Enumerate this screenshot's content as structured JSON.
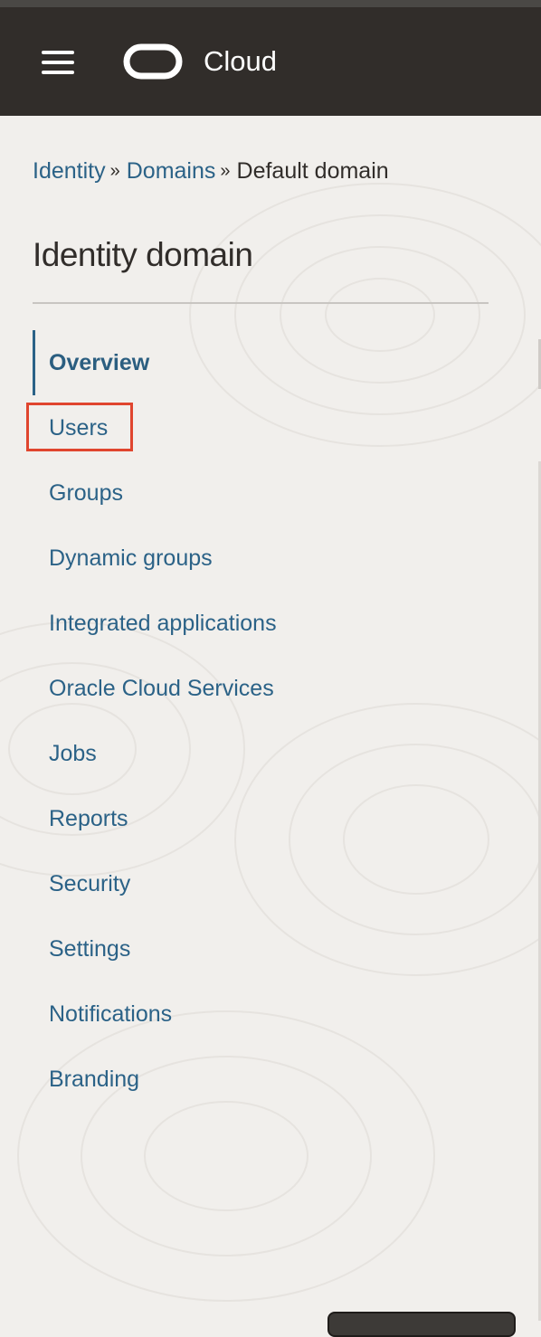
{
  "header": {
    "brand": "Cloud",
    "menu_icon": "hamburger-menu-icon",
    "logo_icon": "oracle-logo-icon"
  },
  "breadcrumb": {
    "items": [
      "Identity",
      "Domains"
    ],
    "current": "Default domain",
    "separator": "»"
  },
  "page": {
    "title": "Identity domain"
  },
  "nav": {
    "active": "Overview",
    "items": [
      "Overview",
      "Users",
      "Groups",
      "Dynamic groups",
      "Integrated applications",
      "Oracle Cloud Services",
      "Jobs",
      "Reports",
      "Security",
      "Settings",
      "Notifications",
      "Branding"
    ]
  },
  "colors": {
    "header_bg": "#312d2a",
    "page_bg": "#f1efec",
    "link": "#2b6287",
    "text": "#312d2a",
    "highlight": "#e0452e"
  }
}
